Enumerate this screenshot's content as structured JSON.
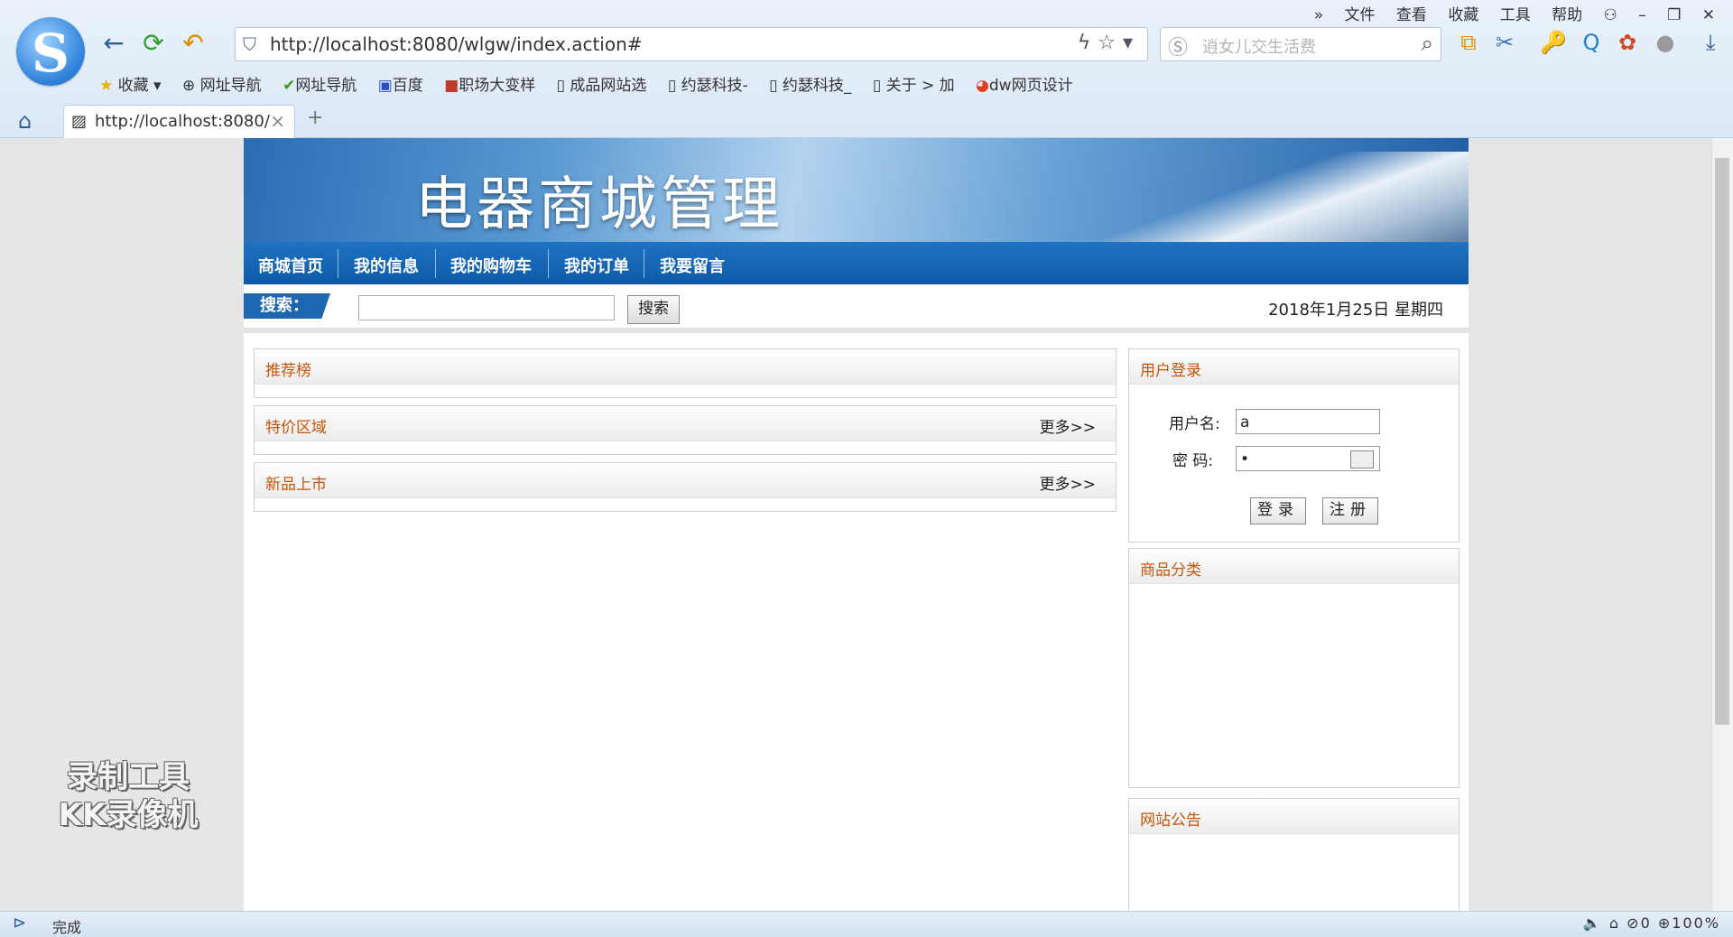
{
  "browser": {
    "url": "http://localhost:8080/wlgw/index.action#",
    "search_placeholder": "逍女儿交生活费",
    "menu": [
      "文件",
      "查看",
      "收藏",
      "工具",
      "帮助"
    ],
    "bookmarks": [
      "收藏",
      "网址导航",
      "网址导航",
      "百度",
      "职场大变样",
      "成品网站选",
      "约瑟科技-",
      "约瑟科技_",
      "关于 > 加",
      "dw网页设计"
    ],
    "tab_title": "http://localhost:8080/",
    "status": "完成",
    "status_right": "0",
    "zoom": "100%"
  },
  "site": {
    "banner_title": "电器商城管理",
    "nav": [
      "商城首页",
      "我的信息",
      "我的购物车",
      "我的订单",
      "我要留言"
    ],
    "search_label": "搜索：",
    "search_button": "搜索",
    "date": "2018年1月25日 星期四"
  },
  "left_panels": [
    {
      "title": "推荐榜",
      "more": ""
    },
    {
      "title": "特价区域",
      "more": "更多>>"
    },
    {
      "title": "新品上市",
      "more": "更多>>"
    }
  ],
  "login": {
    "title": "用户登录",
    "username_label": "用户名:",
    "username_value": "a",
    "password_label": "密 码:",
    "password_value": "•",
    "login_button": "登录",
    "register_button": "注册"
  },
  "category": {
    "title": "商品分类"
  },
  "notice": {
    "title": "网站公告"
  },
  "watermark": [
    "录制工具",
    "KK录像机"
  ]
}
